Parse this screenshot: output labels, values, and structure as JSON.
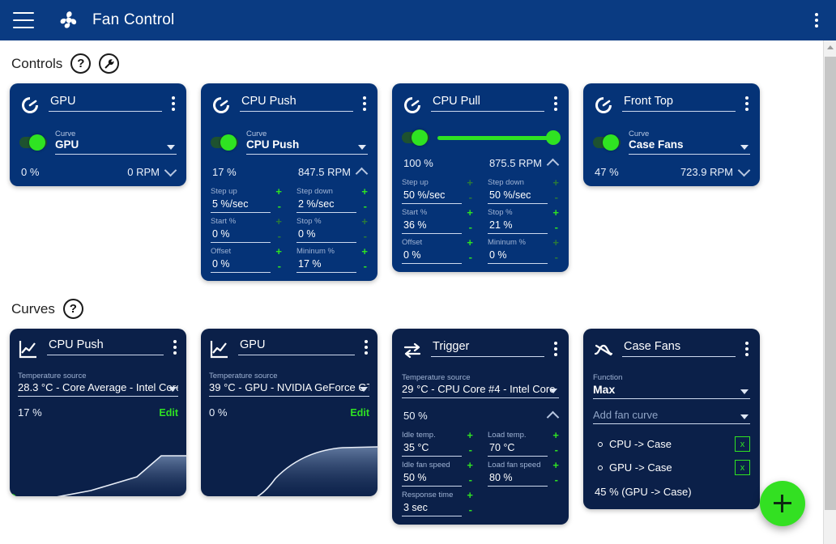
{
  "titlebar": {
    "menu_icon": "hamburger-icon",
    "logo_icon": "fan-icon",
    "title": "Fan Control",
    "overflow_icon": "kebab-menu-icon"
  },
  "sections": {
    "controls": {
      "title": "Controls",
      "help_label": "?",
      "settings_icon": "wrench-icon"
    },
    "curves": {
      "title": "Curves",
      "help_label": "?"
    }
  },
  "controls": [
    {
      "icon": "gauge-icon",
      "name": "GPU",
      "toggle_on": true,
      "mode": "curve",
      "curve_label": "Curve",
      "curve_value": "GPU",
      "percent": "0 %",
      "rpm": "0 RPM",
      "expanded": false
    },
    {
      "icon": "gauge-icon",
      "name": "CPU Push",
      "toggle_on": true,
      "mode": "curve",
      "curve_label": "Curve",
      "curve_value": "CPU Push",
      "percent": "17 %",
      "rpm": "847.5 RPM",
      "expanded": true,
      "fields": [
        {
          "label": "Step up",
          "value": "5 %/sec",
          "dim": false
        },
        {
          "label": "Step down",
          "value": "2 %/sec",
          "dim": false
        },
        {
          "label": "Start %",
          "value": "0 %",
          "dim": true
        },
        {
          "label": "Stop %",
          "value": "0 %",
          "dim": true
        },
        {
          "label": "Offset",
          "value": "0 %",
          "dim": false
        },
        {
          "label": "Mininum %",
          "value": "17 %",
          "dim": false
        }
      ]
    },
    {
      "icon": "gauge-icon",
      "name": "CPU Pull",
      "toggle_on": true,
      "mode": "slider",
      "slider_value": 100,
      "percent": "100 %",
      "rpm": "875.5 RPM",
      "expanded": true,
      "fields": [
        {
          "label": "Step up",
          "value": "50 %/sec",
          "dim": true
        },
        {
          "label": "Step down",
          "value": "50 %/sec",
          "dim": true
        },
        {
          "label": "Start %",
          "value": "36 %",
          "dim": false
        },
        {
          "label": "Stop %",
          "value": "21 %",
          "dim": false
        },
        {
          "label": "Offset",
          "value": "0 %",
          "dim": false
        },
        {
          "label": "Mininum %",
          "value": "0 %",
          "dim": true
        }
      ]
    },
    {
      "icon": "gauge-icon",
      "name": "Front Top",
      "toggle_on": true,
      "mode": "curve",
      "curve_label": "Curve",
      "curve_value": "Case Fans",
      "percent": "47 %",
      "rpm": "723.9 RPM",
      "expanded": false
    }
  ],
  "curves": [
    {
      "type": "graph",
      "icon": "line-chart-icon",
      "name": "CPU Push",
      "source_label": "Temperature source",
      "source_value": "28.3 °C - Core Average - Intel Core",
      "percent": "17 %",
      "edit_label": "Edit",
      "chart_data": {
        "type": "line",
        "points": [
          [
            0,
            8
          ],
          [
            24,
            8
          ],
          [
            46,
            17
          ],
          [
            72,
            37
          ],
          [
            86,
            60
          ],
          [
            100,
            60
          ]
        ],
        "marker_x": 1,
        "marker_y": 8,
        "ylim": [
          0,
          100
        ],
        "xlim": [
          0,
          100
        ],
        "grid": false
      }
    },
    {
      "type": "graph",
      "icon": "line-chart-icon",
      "name": "GPU",
      "source_label": "Temperature source",
      "source_value": "39 °C - GPU - NVIDIA GeForce GT)",
      "percent": "0 %",
      "edit_label": "Edit",
      "chart_data": {
        "type": "line",
        "points": [
          [
            0,
            2
          ],
          [
            24,
            2
          ],
          [
            38,
            28
          ],
          [
            55,
            48
          ],
          [
            75,
            58
          ],
          [
            100,
            62
          ]
        ],
        "marker_x": 15,
        "marker_y": 2,
        "ylim": [
          0,
          100
        ],
        "xlim": [
          0,
          100
        ],
        "grid": false
      }
    },
    {
      "type": "trigger",
      "icon": "trigger-arrows-icon",
      "name": "Trigger",
      "source_label": "Temperature source",
      "source_value": "29 °C - CPU Core #4 - Intel Core",
      "percent": "50 %",
      "expanded": true,
      "fields": [
        {
          "label": "Idle temp.",
          "value": "35 °C",
          "dim": false
        },
        {
          "label": "Load temp.",
          "value": "70 °C",
          "dim": false
        },
        {
          "label": "Idle fan speed",
          "value": "50 %",
          "dim": false
        },
        {
          "label": "Load fan speed",
          "value": "80 %",
          "dim": false
        },
        {
          "label": "Response time",
          "value": "3 sec",
          "dim": false
        }
      ]
    },
    {
      "type": "mix",
      "icon": "mix-chart-icon",
      "name": "Case Fans",
      "function_label": "Function",
      "function_value": "Max",
      "add_placeholder": "Add fan curve",
      "items": [
        {
          "label": "CPU -> Case",
          "remove": "x"
        },
        {
          "label": "GPU -> Case",
          "remove": "x"
        }
      ],
      "total": "45 % (GPU -> Case)"
    }
  ],
  "fab": {
    "icon": "plus-icon",
    "label": "+"
  },
  "scrollbar": {
    "up_icon": "scroll-up-arrow-icon"
  }
}
